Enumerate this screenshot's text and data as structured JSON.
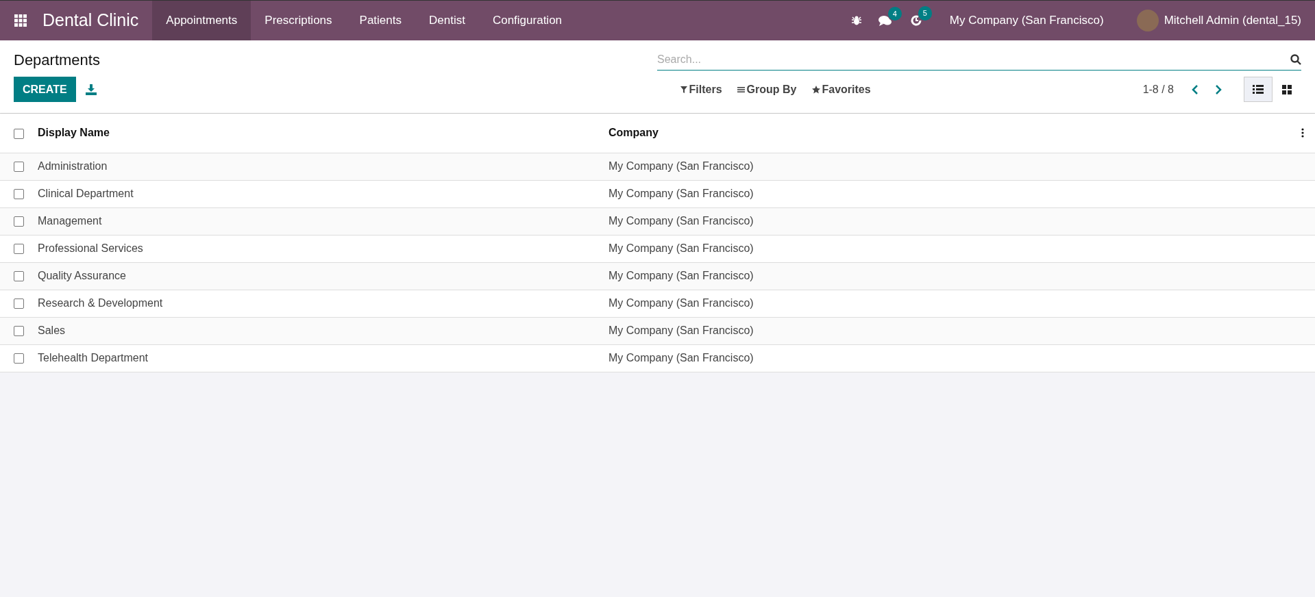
{
  "navbar": {
    "app_title": "Dental Clinic",
    "menu": [
      {
        "label": "Appointments",
        "selected": true
      },
      {
        "label": "Prescriptions",
        "selected": false
      },
      {
        "label": "Patients",
        "selected": false
      },
      {
        "label": "Dentist",
        "selected": false
      },
      {
        "label": "Configuration",
        "selected": false
      }
    ],
    "messages_count": "4",
    "activities_count": "5",
    "company": "My Company (San Francisco)",
    "user": "Mitchell Admin (dental_15)"
  },
  "control_panel": {
    "title": "Departments",
    "create_button": "CREATE",
    "search": {
      "placeholder": "Search..."
    },
    "filters": "Filters",
    "group_by": "Group By",
    "favorites": "Favorites",
    "pager": "1-8 / 8",
    "views": [
      {
        "kind": "list",
        "selected": true
      },
      {
        "kind": "kanban",
        "selected": false
      }
    ]
  },
  "table": {
    "select_all": {
      "checked": false
    },
    "columns": [
      "Display Name",
      "Company"
    ],
    "rows": [
      {
        "checked": false,
        "cells": [
          "Administration",
          "My Company (San Francisco)"
        ]
      },
      {
        "checked": false,
        "cells": [
          "Clinical Department",
          "My Company (San Francisco)"
        ]
      },
      {
        "checked": false,
        "cells": [
          "Management",
          "My Company (San Francisco)"
        ]
      },
      {
        "checked": false,
        "cells": [
          "Professional Services",
          "My Company (San Francisco)"
        ]
      },
      {
        "checked": false,
        "cells": [
          "Quality Assurance",
          "My Company (San Francisco)"
        ]
      },
      {
        "checked": false,
        "cells": [
          "Research & Development",
          "My Company (San Francisco)"
        ]
      },
      {
        "checked": false,
        "cells": [
          "Sales",
          "My Company (San Francisco)"
        ]
      },
      {
        "checked": false,
        "cells": [
          "Telehealth Department",
          "My Company (San Francisco)"
        ]
      }
    ]
  }
}
